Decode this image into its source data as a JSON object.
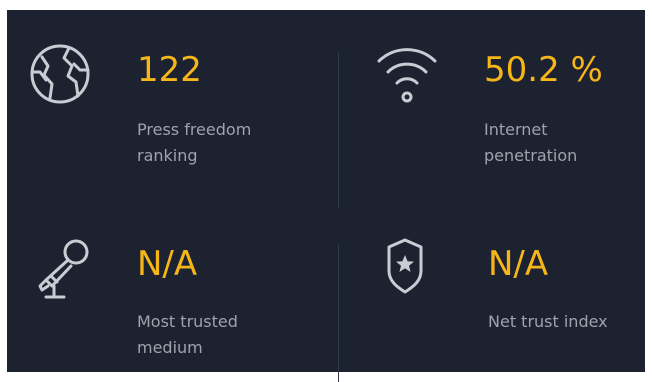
{
  "stats": [
    {
      "icon": "globe-icon",
      "value": "122",
      "label_line1": "Press freedom",
      "label_line2": "ranking"
    },
    {
      "icon": "wifi-icon",
      "value": "50.2 %",
      "label_line1": "Internet",
      "label_line2": "penetration"
    },
    {
      "icon": "microphone-icon",
      "value": "N/A",
      "label_line1": "Most trusted",
      "label_line2": "medium"
    },
    {
      "icon": "shield-star-icon",
      "value": "N/A",
      "label_line1": "Net trust index",
      "label_line2": ""
    }
  ],
  "colors": {
    "background": "#1c2230",
    "accent": "#f6b619",
    "label": "#9ea3ad",
    "icon": "#c8ccd3",
    "divider": "#343c4c"
  }
}
